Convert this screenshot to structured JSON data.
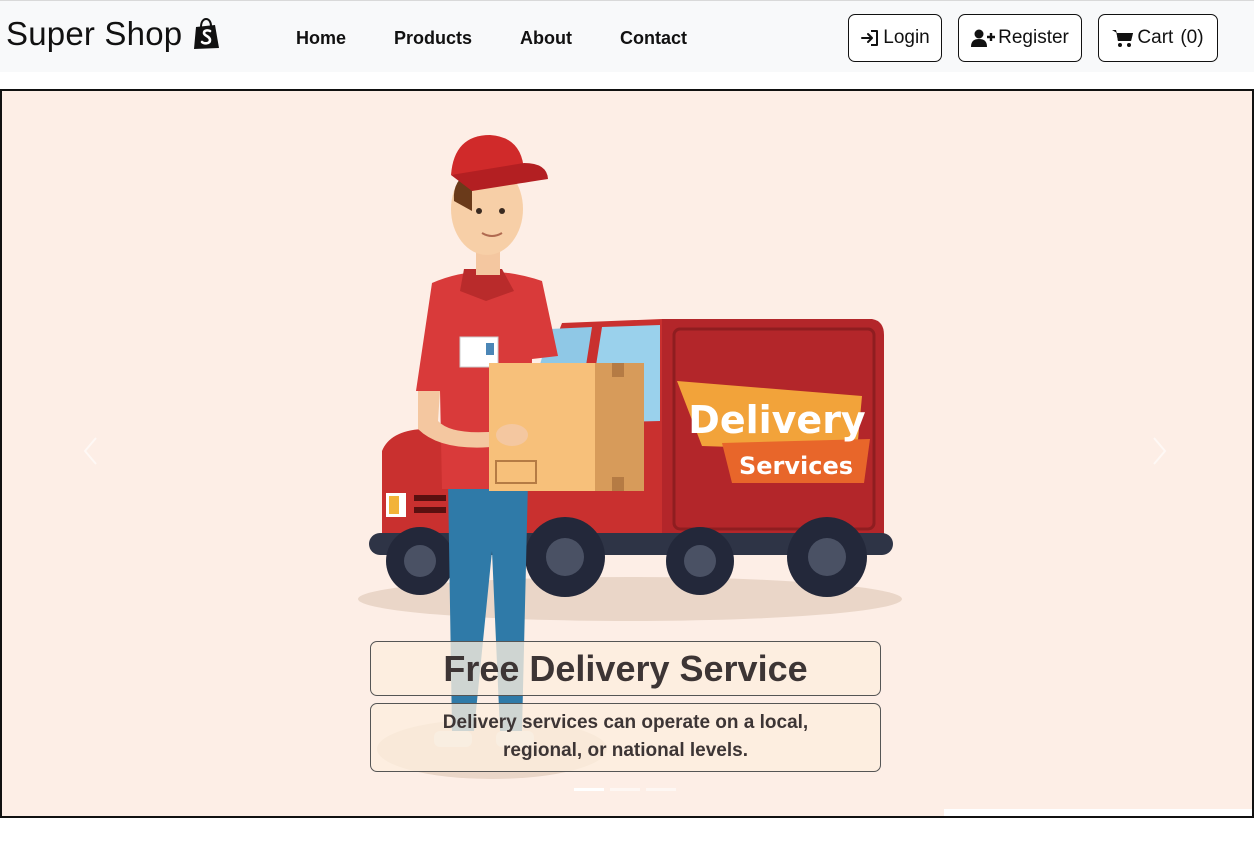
{
  "brand": {
    "name": "Super Shop",
    "icon": "shopify-bag-icon"
  },
  "nav": {
    "links": [
      {
        "label": "Home"
      },
      {
        "label": "Products"
      },
      {
        "label": "About"
      },
      {
        "label": "Contact"
      }
    ]
  },
  "auth": {
    "login_label": "Login",
    "login_icon": "sign-in-icon",
    "register_label": "Register",
    "register_icon": "user-plus-icon"
  },
  "cart": {
    "label": "Cart",
    "count": "(0)",
    "icon": "shopping-cart-icon"
  },
  "carousel": {
    "title": "Free Delivery Service",
    "subtitle_line1": "Delivery services can operate on a local,",
    "subtitle_line2": "regional, or national levels.",
    "van_sign_line1": "Delivery",
    "van_sign_line2": "Services",
    "slide_count": 3,
    "active_slide": 1
  },
  "colors": {
    "navbar_bg": "#f8f9fa",
    "hero_bg": "#fdeee6",
    "van_red": "#b3262a",
    "shirt_red": "#d93a3a",
    "sign_orange": "#f2a33a",
    "caption_text": "#3d3535"
  }
}
